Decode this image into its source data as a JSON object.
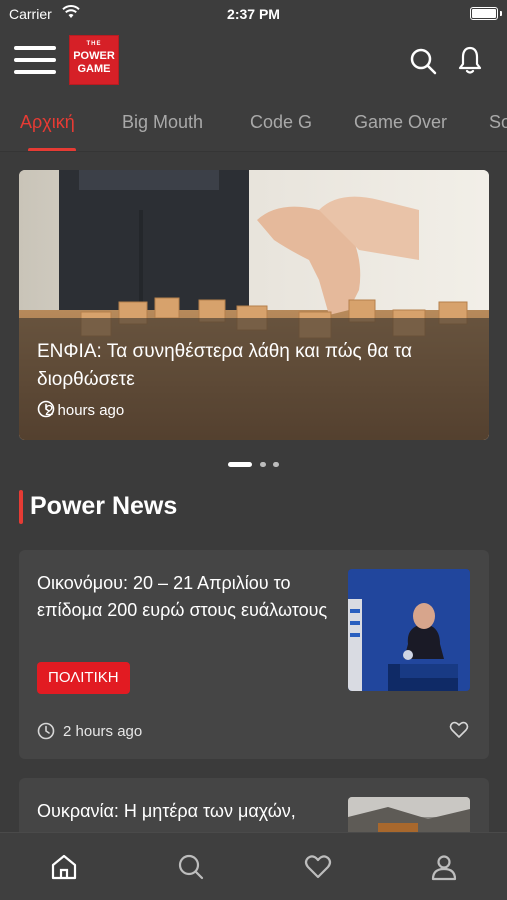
{
  "status": {
    "carrier": "Carrier",
    "time": "2:37 PM"
  },
  "header": {
    "logo_top": "THE",
    "logo_line1": "POWER",
    "logo_line2": "GAME"
  },
  "tabs": [
    {
      "label": "Αρχική",
      "active": true
    },
    {
      "label": "Big Mouth",
      "active": false
    },
    {
      "label": "Code G",
      "active": false
    },
    {
      "label": "Game Over",
      "active": false
    },
    {
      "label": "So",
      "active": false
    }
  ],
  "hero": {
    "title": "ΕΝΦΙΑ: Τα συνηθέστερα λάθη και πώς θα τα διορθώσετε",
    "time": "2 hours ago"
  },
  "section": {
    "title": "Power News"
  },
  "articles": [
    {
      "title": "Οικονόμου: 20 – 21 Απριλίου το επίδομα 200 ευρώ στους ευάλωτους",
      "tag": "ΠΟΛΙΤΙΚΗ",
      "time": "2 hours ago"
    },
    {
      "title": "Ουκρανία: Η μητέρα των μαχών,"
    }
  ],
  "colors": {
    "accent": "#e63b34",
    "background": "#3b3b3b",
    "card": "#454545",
    "tag": "#e21b22"
  },
  "icons": [
    "menu-icon",
    "search-icon",
    "bell-icon",
    "clock-icon",
    "heart-icon",
    "home-icon",
    "user-icon"
  ]
}
